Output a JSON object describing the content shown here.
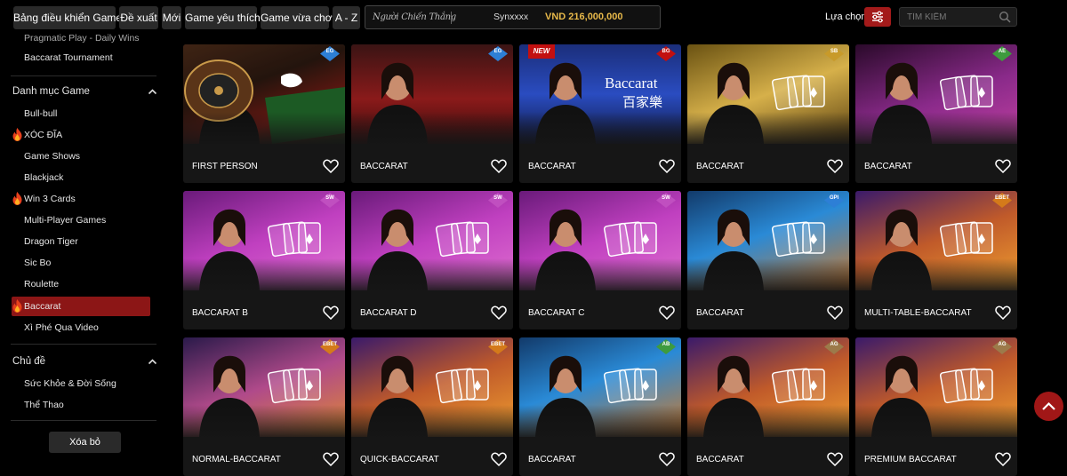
{
  "nav": {
    "tabs": [
      "Bảng điều khiển Game",
      "Đề xuất",
      "Mới",
      "Game yêu thích",
      "Game vừa chơi",
      "A - Z"
    ]
  },
  "winner": {
    "label": "Người Chiến Thắng",
    "user": "Synxxxx",
    "amount": "VND 216,000,000"
  },
  "filter": {
    "label": "Lựa chọn"
  },
  "search": {
    "placeholder": "TÌM KIẾM"
  },
  "sidebar": {
    "partial_items": [
      "Pragmatic Play - Daily Wins",
      "Baccarat Tournament"
    ],
    "category_title": "Danh mục Game",
    "categories": [
      "Bull-bull",
      "XÓC ĐĨA",
      "Game Shows",
      "Blackjack",
      "Win 3 Cards",
      "Multi-Player Games",
      "Dragon Tiger",
      "Sic Bo",
      "Roulette",
      "Baccarat",
      "Xì Phé Qua Video"
    ],
    "hot_categories": [
      "XÓC ĐĨA",
      "Win 3 Cards",
      "Baccarat"
    ],
    "active_category": "Baccarat",
    "topic_title": "Chủ đề",
    "topics": [
      "Sức Khỏe & Đời Sống",
      "Thể Thao"
    ],
    "clear_label": "Xóa bỏ"
  },
  "games": [
    {
      "name": "FIRST PERSON",
      "provider": "EG",
      "theme": "roulette",
      "tag": ""
    },
    {
      "name": "BACCARAT",
      "provider": "EG",
      "theme": "table",
      "tag": ""
    },
    {
      "name": "BACCARAT",
      "provider": "BG",
      "theme": "bg",
      "tag": "NEW",
      "title": "Baccarat",
      "subtitle": "百家樂"
    },
    {
      "name": "BACCARAT",
      "provider": "SB",
      "theme": "gold",
      "tag": ""
    },
    {
      "name": "BACCARAT",
      "provider": "AE",
      "theme": "pink",
      "tag": ""
    },
    {
      "name": "BACCARAT B",
      "provider": "SW",
      "theme": "magenta",
      "tag": ""
    },
    {
      "name": "BACCARAT D",
      "provider": "SW",
      "theme": "magenta",
      "tag": ""
    },
    {
      "name": "BACCARAT C",
      "provider": "SW",
      "theme": "magenta",
      "tag": ""
    },
    {
      "name": "BACCARAT",
      "provider": "GPI",
      "theme": "cyan",
      "tag": ""
    },
    {
      "name": "MULTI-TABLE-BACCARAT",
      "provider": "EBET",
      "theme": "orange",
      "tag": ""
    },
    {
      "name": "NORMAL-BACCARAT",
      "provider": "EBET",
      "theme": "purple",
      "tag": ""
    },
    {
      "name": "QUICK-BACCARAT",
      "provider": "EBET",
      "theme": "orange",
      "tag": ""
    },
    {
      "name": "BACCARAT",
      "provider": "AB",
      "theme": "cyan",
      "tag": ""
    },
    {
      "name": "BACCARAT",
      "provider": "AG",
      "theme": "orange",
      "tag": ""
    },
    {
      "name": "PREMIUM BACCARAT",
      "provider": "AG",
      "theme": "orange",
      "tag": ""
    }
  ],
  "colors": {
    "accent": "#8c1616",
    "badge_blue": "#2d7fd6",
    "badge_red": "#c21010",
    "badge_gold": "#c89a2a",
    "badge_green": "#3e9b3e",
    "badge_pink": "#c04fc0",
    "badge_orange": "#d47a1a",
    "badge_bronze": "#9c7a4a"
  },
  "icons": {
    "filter": "filter-icon",
    "search": "search-icon",
    "heart": "heart-icon",
    "chevron": "chevron-up-icon",
    "fire": "fire-icon",
    "scroll_top": "chevron-up-icon"
  }
}
